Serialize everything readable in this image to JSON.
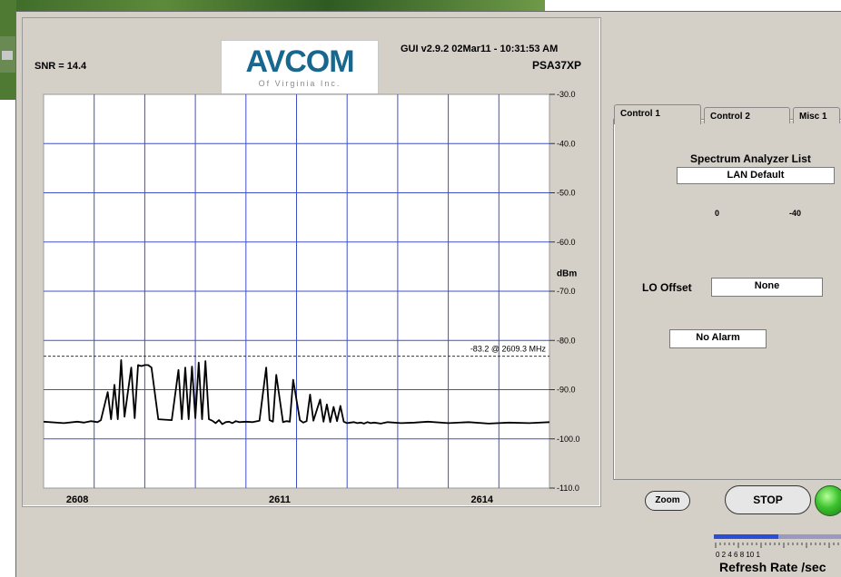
{
  "header": {
    "snr": "SNR = 14.4",
    "gui_info": "GUI v2.9.2  02Mar11 - 10:31:53 AM",
    "model": "PSA37XP"
  },
  "logo": {
    "name": "AVCOM",
    "subtitle": "Of Virginia Inc."
  },
  "chart_data": {
    "type": "line",
    "xlim": [
      2607.5,
      2615.0
    ],
    "ylim": [
      -110,
      -30
    ],
    "x_ticks": [
      {
        "value": 2608,
        "label": "2608"
      },
      {
        "value": 2611,
        "label": "2611"
      },
      {
        "value": 2614,
        "label": "2614"
      }
    ],
    "y_ticks": [
      {
        "value": -30,
        "label": "-30.0"
      },
      {
        "value": -40,
        "label": "-40.0"
      },
      {
        "value": -50,
        "label": "-50.0"
      },
      {
        "value": -60,
        "label": "-60.0"
      },
      {
        "value": -70,
        "label": "-70.0"
      },
      {
        "value": -80,
        "label": "-80.0"
      },
      {
        "value": -90,
        "label": "-90.0"
      },
      {
        "value": -100,
        "label": "-100.0"
      },
      {
        "value": -110,
        "label": "-110.0"
      }
    ],
    "ylabel": "dBm",
    "marker": {
      "value": -83.2,
      "label": "-83.2 @ 2609.3 MHz"
    },
    "grid": true,
    "series": [
      {
        "color": "#000000",
        "x": [
          2607.5,
          2607.8,
          2608.0,
          2608.1,
          2608.2,
          2608.3,
          2608.35,
          2608.45,
          2608.5,
          2608.55,
          2608.6,
          2608.65,
          2608.7,
          2608.8,
          2608.85,
          2608.9,
          2608.95,
          2609.0,
          2609.05,
          2609.1,
          2609.2,
          2609.4,
          2609.5,
          2609.55,
          2609.6,
          2609.65,
          2609.7,
          2609.75,
          2609.8,
          2609.85,
          2609.9,
          2609.95,
          2610.0,
          2610.05,
          2610.1,
          2610.15,
          2610.2,
          2610.25,
          2610.3,
          2610.35,
          2610.4,
          2610.5,
          2610.6,
          2610.7,
          2610.8,
          2610.85,
          2610.9,
          2610.95,
          2611.05,
          2611.1,
          2611.15,
          2611.2,
          2611.3,
          2611.35,
          2611.4,
          2611.45,
          2611.5,
          2611.6,
          2611.65,
          2611.7,
          2611.75,
          2611.8,
          2611.85,
          2611.9,
          2611.95,
          2612.0,
          2612.05,
          2612.1,
          2612.15,
          2612.2,
          2612.25,
          2612.3,
          2612.35,
          2612.4,
          2612.5,
          2612.6,
          2612.8,
          2613.0,
          2613.2,
          2613.5,
          2613.8,
          2614.1,
          2614.4,
          2614.7,
          2615.0
        ],
        "values": [
          -96.5,
          -96.8,
          -96.5,
          -96.7,
          -96.4,
          -96.6,
          -96.2,
          -90.5,
          -96.0,
          -89.0,
          -96.0,
          -84.0,
          -95.5,
          -85.5,
          -95.8,
          -85.0,
          -85.2,
          -85.0,
          -85.0,
          -85.5,
          -96.0,
          -96.2,
          -86.0,
          -96.0,
          -85.5,
          -96.0,
          -85.3,
          -95.8,
          -84.5,
          -96.0,
          -84.2,
          -96.0,
          -96.3,
          -96.8,
          -96.2,
          -97.0,
          -96.6,
          -96.5,
          -96.8,
          -96.4,
          -96.6,
          -96.5,
          -96.6,
          -96.3,
          -85.5,
          -96.2,
          -96.5,
          -87.0,
          -96.6,
          -96.4,
          -96.5,
          -88.0,
          -96.2,
          -96.7,
          -96.4,
          -91.0,
          -96.3,
          -92.0,
          -96.5,
          -93.0,
          -96.6,
          -93.5,
          -96.4,
          -93.3,
          -96.5,
          -96.8,
          -96.7,
          -96.6,
          -96.8,
          -96.7,
          -96.9,
          -96.6,
          -96.8,
          -96.7,
          -96.9,
          -96.6,
          -96.8,
          -96.7,
          -96.5,
          -96.8,
          -96.6,
          -96.9,
          -96.7,
          -96.8,
          -96.6
        ]
      }
    ]
  },
  "tabs": [
    {
      "label": "Control 1"
    },
    {
      "label": "Control 2"
    },
    {
      "label": "Misc 1"
    }
  ],
  "control_panel": {
    "spectrum_list_label": "Spectrum Analyzer List",
    "spectrum_list_value": "LAN Default",
    "level_left": "0",
    "level_right": "-40",
    "lo_offset_label": "LO Offset",
    "lo_offset_value": "None",
    "alarm_value": "No Alarm"
  },
  "buttons": {
    "zoom": "Zoom",
    "stop": "STOP"
  },
  "status_led_color": "#3cc22e",
  "refresh": {
    "label": "Refresh Rate /sec",
    "scale_text": "0   2   4   6   8   10   1",
    "value_fraction": 0.5
  }
}
